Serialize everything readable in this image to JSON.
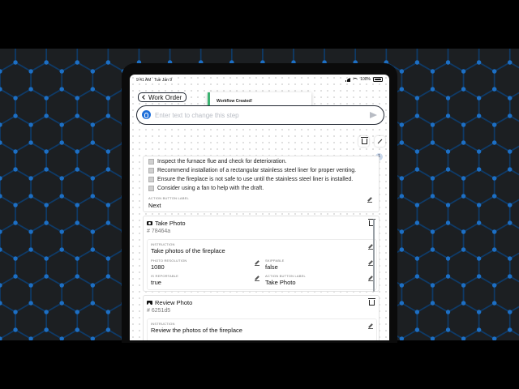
{
  "status_bar": {
    "time": "9:41 AM",
    "date": "Tue Jan 9",
    "battery": "100%"
  },
  "header": {
    "back_label": "Work Order"
  },
  "toast": {
    "message": "Workflow Created!",
    "accent": "#3cb371"
  },
  "prompt": {
    "placeholder": "Enter text to change this step"
  },
  "badge": {
    "count": "1"
  },
  "step_one": {
    "bullets": [
      "Inspect the furnace flue and check for deterioration.",
      "Recommend installation of a rectangular stainless steel liner for proper venting.",
      "Ensure the fireplace is not safe to use until the stainless steel liner is installed.",
      "Consider using a fan to help with the draft."
    ],
    "action_label_caption": "ACTION BUTTON LABEL",
    "action_label_value": "Next"
  },
  "take_photo": {
    "title": "Take Photo",
    "id": "# 78464a",
    "instruction_caption": "INSTRUCTION",
    "instruction_value": "Take photos of the fireplace",
    "resolution_caption": "PHOTO RESOLUTION",
    "resolution_value": "1080",
    "skippable_caption": "SKIPPABLE",
    "skippable_value": "false",
    "reportable_caption": "IS REPORTABLE",
    "reportable_value": "true",
    "action_caption": "ACTION BUTTON LABEL",
    "action_value": "Take Photo"
  },
  "review_photo": {
    "title": "Review Photo",
    "id": "# 6251d5",
    "instruction_caption": "INSTRUCTION",
    "instruction_value": "Review the photos of the fireplace"
  },
  "colors": {
    "background": "#1c1f22",
    "hex_lines": "#0f3a66",
    "hex_nodes": "#1d6fc4",
    "brand": "#1e6fd9"
  }
}
